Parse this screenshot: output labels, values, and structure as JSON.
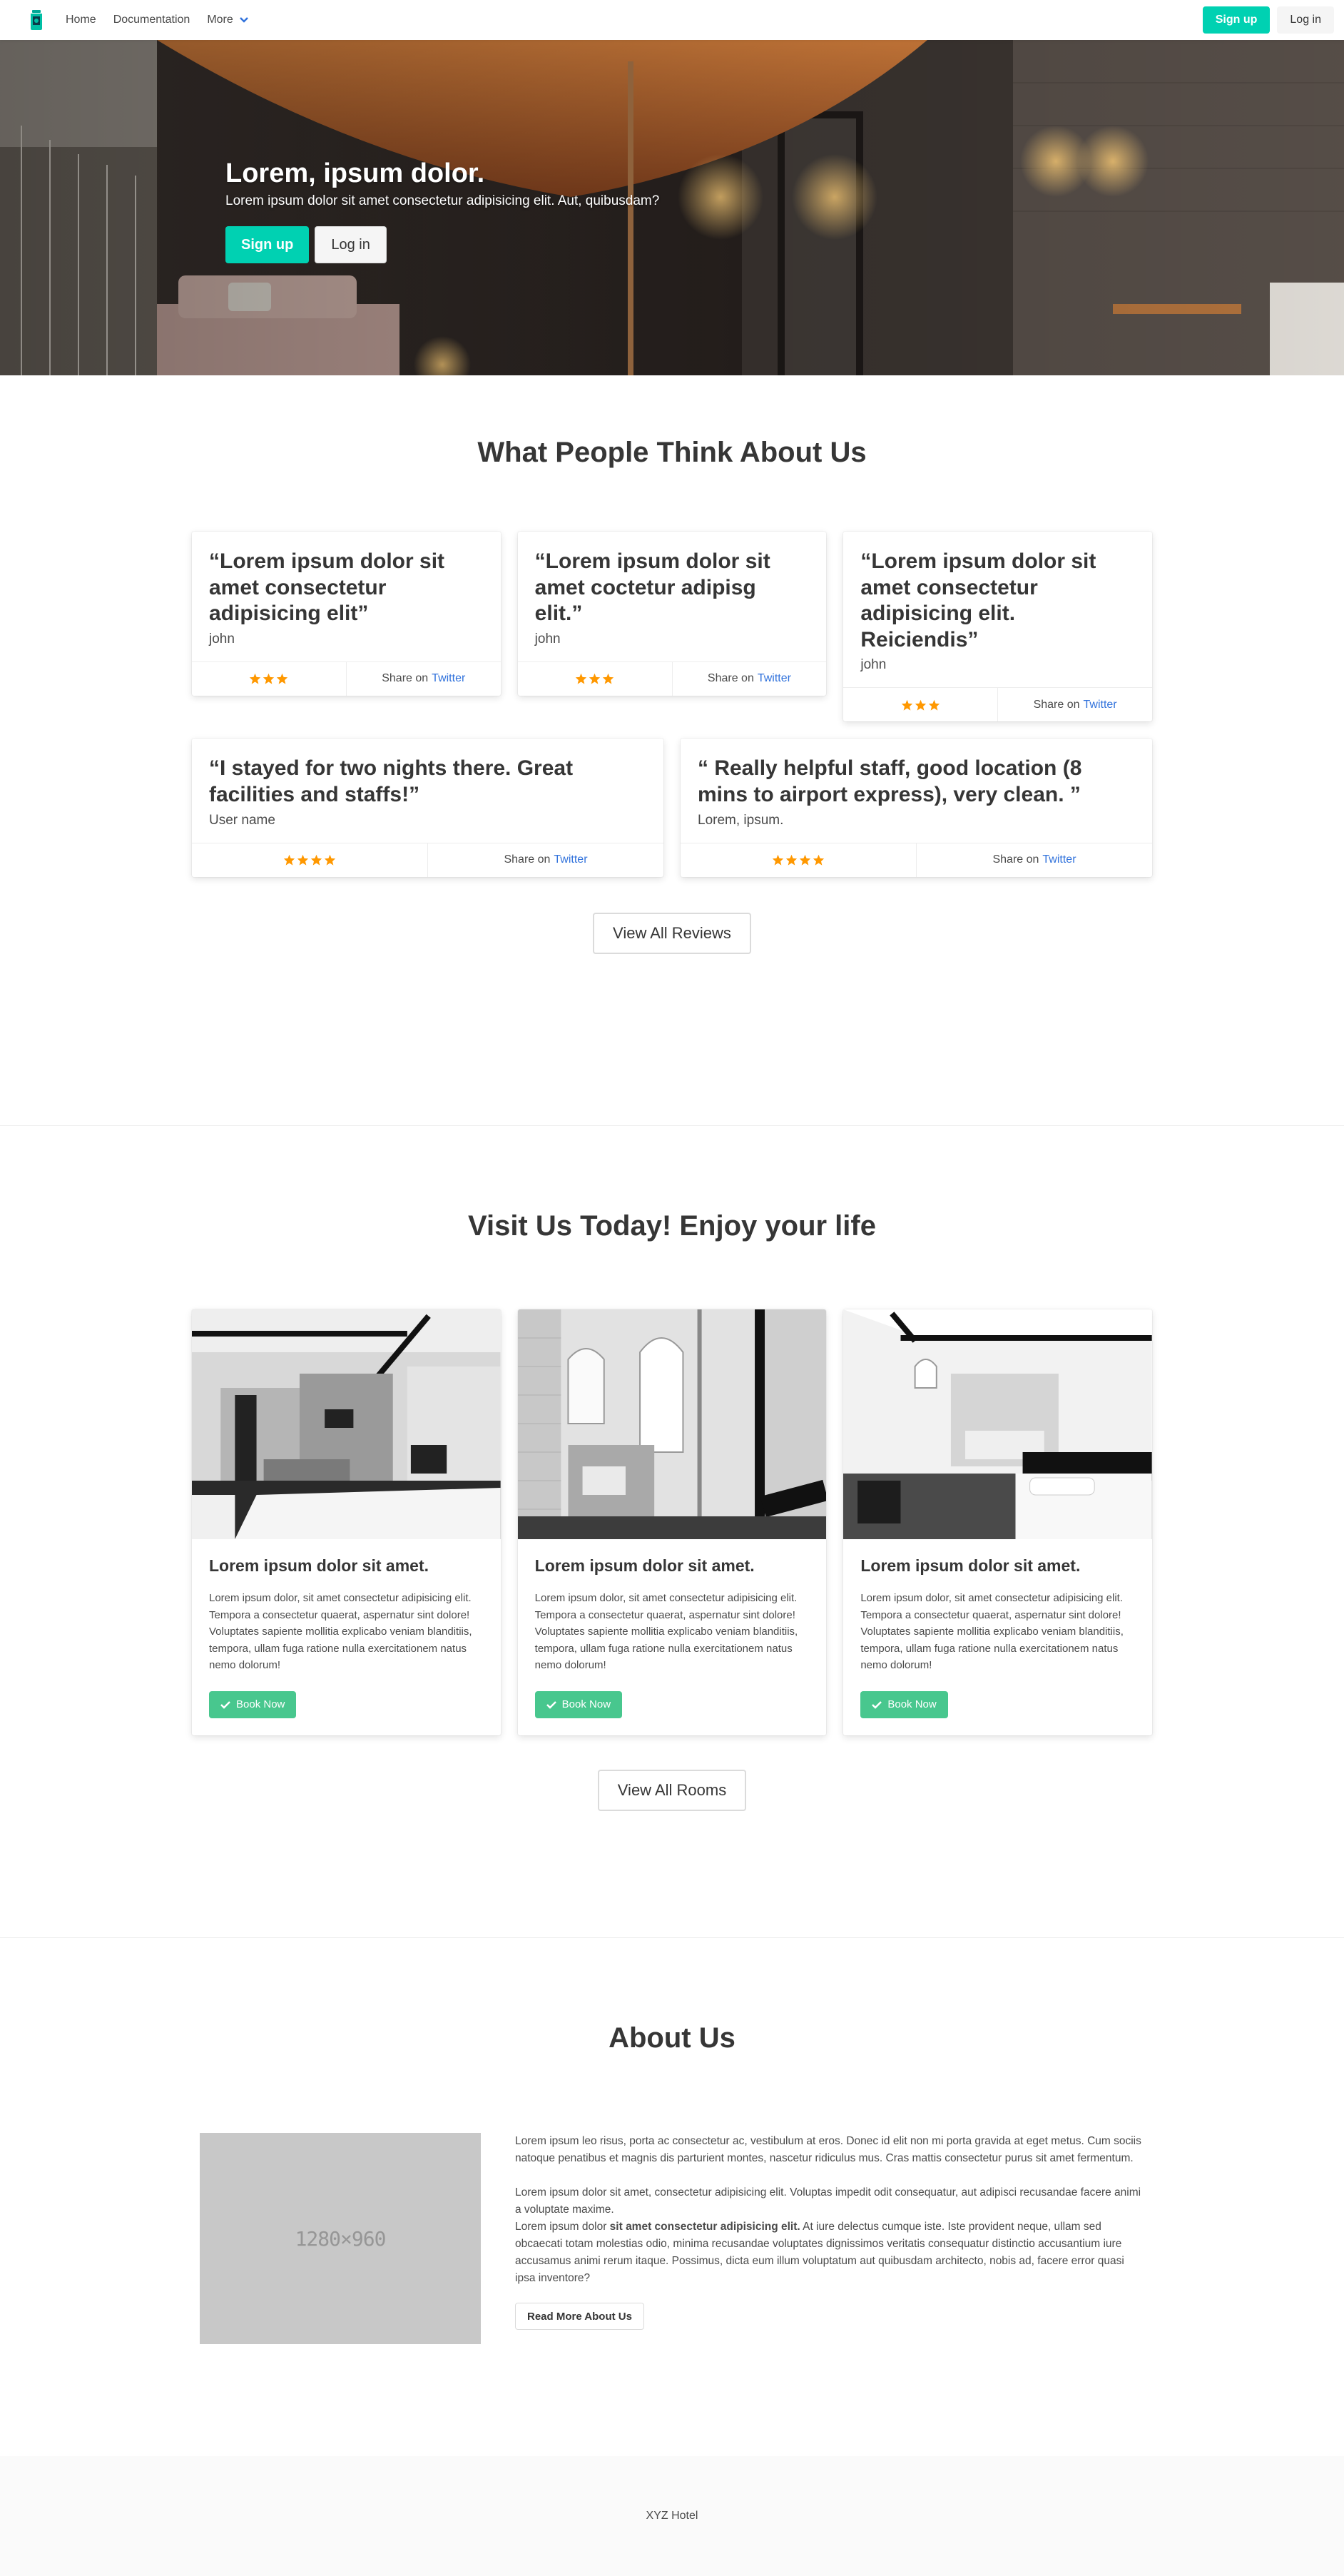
{
  "nav": {
    "logo_icon": "bottle-logo-icon",
    "links": [
      "Home",
      "Documentation",
      "More"
    ],
    "more_icon": "chevron-down-icon",
    "signup": "Sign up",
    "login": "Log in"
  },
  "hero": {
    "title": "Lorem, ipsum dolor.",
    "subtitle": "Lorem ipsum dolor sit amet consectetur adipisicing elit. Aut, quibusdam?",
    "signup": "Sign up",
    "login": "Log in"
  },
  "reviews": {
    "title": "What People Think About Us",
    "share_prefix": "Share on",
    "share_link": "Twitter",
    "star_color": "#ff9800",
    "items": [
      {
        "quote": "“Lorem ipsum dolor sit amet consectetur adipisicing elit”",
        "author": "john",
        "stars": 3
      },
      {
        "quote": "“Lorem ipsum dolor sit amet coctetur adipisg elit.”",
        "author": "john",
        "stars": 3
      },
      {
        "quote": "“Lorem ipsum dolor sit amet consectetur adipisicing elit. Reiciendis”",
        "author": "john",
        "stars": 3
      },
      {
        "quote": "“I stayed for two nights there. Great facilities and staffs!”",
        "author": "User name",
        "stars": 4
      },
      {
        "quote": "“ Really helpful staff, good location (8 mins to airport express), very clean. ”",
        "author": "Lorem, ipsum.",
        "stars": 4
      }
    ],
    "view_all": "View All Reviews"
  },
  "rooms": {
    "title": "Visit Us Today! Enjoy your life",
    "items": [
      {
        "title": "Lorem ipsum dolor sit amet.",
        "text": "Lorem ipsum dolor, sit amet consectetur adipisicing elit. Tempora a consectetur quaerat, aspernatur sint dolore! Voluptates sapiente mollitia explicabo veniam blanditiis, tempora, ullam fuga ratione nulla exercitationem natus nemo dolorum!",
        "button": "Book Now"
      },
      {
        "title": "Lorem ipsum dolor sit amet.",
        "text": "Lorem ipsum dolor, sit amet consectetur adipisicing elit. Tempora a consectetur quaerat, aspernatur sint dolore! Voluptates sapiente mollitia explicabo veniam blanditiis, tempora, ullam fuga ratione nulla exercitationem natus nemo dolorum!",
        "button": "Book Now"
      },
      {
        "title": "Lorem ipsum dolor sit amet.",
        "text": "Lorem ipsum dolor, sit amet consectetur adipisicing elit. Tempora a consectetur quaerat, aspernatur sint dolore! Voluptates sapiente mollitia explicabo veniam blanditiis, tempora, ullam fuga ratione nulla exercitationem natus nemo dolorum!",
        "button": "Book Now"
      }
    ],
    "view_all": "View All Rooms",
    "accent": "#48c78e"
  },
  "about": {
    "title": "About Us",
    "image_placeholder": "1280×960",
    "para1": "Lorem ipsum leo risus, porta ac consectetur ac, vestibulum at eros. Donec id elit non mi porta gravida at eget metus. Cum sociis natoque penatibus et magnis dis parturient montes, nascetur ridiculus mus. Cras mattis consectetur purus sit amet fermentum.",
    "para2": "Lorem ipsum dolor sit amet, consectetur adipisicing elit. Voluptas impedit odit consequatur, aut adipisci recusandae facere animi a voluptate maxime.",
    "para3_start": "Lorem ipsum dolor",
    "para3_bold": "sit amet consectetur adipisicing elit.",
    "para3_end": "At iure delectus cumque iste. Iste provident neque, ullam sed obcaecati totam molestias odio, minima recusandae voluptates dignissimos veritatis consequatur distinctio accusantium iure accusamus animi rerum itaque. Possimus, dicta eum illum voluptatum aut quibusdam architecto, nobis ad, facere error quasi ipsa inventore?",
    "button": "Read More About Us"
  },
  "footer": {
    "text": "XYZ Hotel"
  },
  "colors": {
    "primary": "#00d1b2",
    "link": "#3273dc"
  }
}
